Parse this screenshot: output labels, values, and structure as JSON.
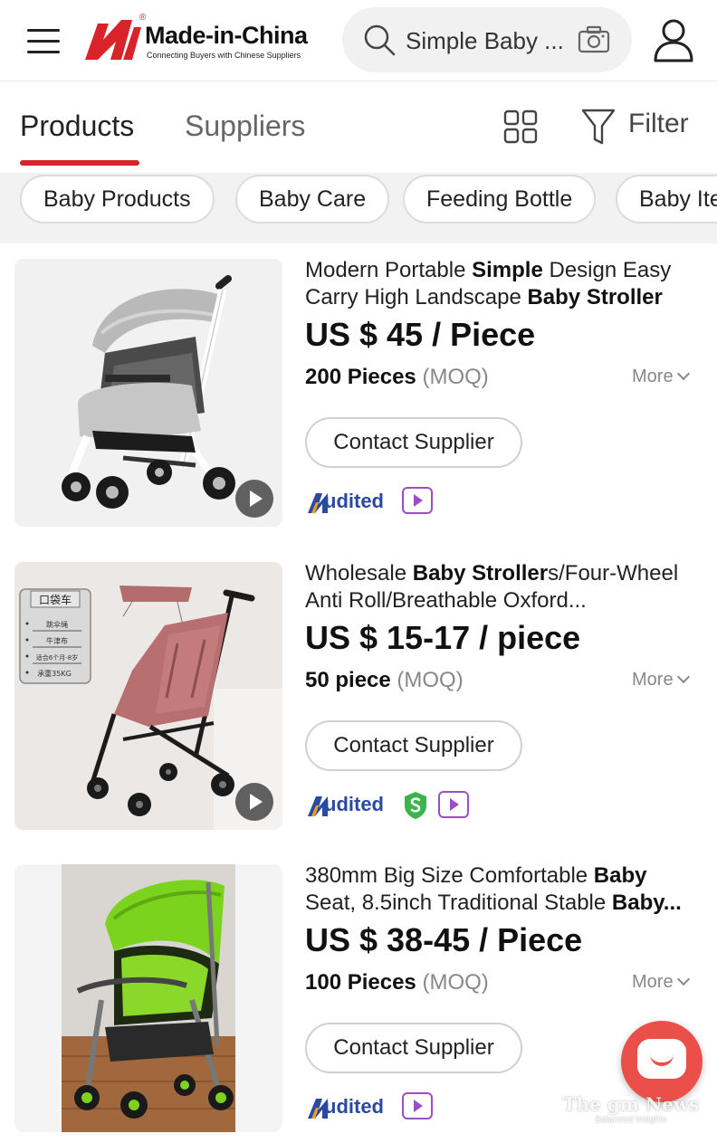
{
  "header": {
    "brand": "Made-in-China",
    "registered": "®",
    "tagline": "Connecting Buyers with Chinese Suppliers",
    "search_text": "Simple Baby ...",
    "accent_color": "#d8232a"
  },
  "tabs": {
    "products": "Products",
    "suppliers": "Suppliers",
    "active": "Products",
    "filter_label": "Filter"
  },
  "chips": [
    "Baby Products",
    "Baby Care",
    "Feeding Bottle",
    "Baby Ite"
  ],
  "products": [
    {
      "title_parts": [
        {
          "t": "Modern Portable ",
          "b": false
        },
        {
          "t": "Simple",
          "b": true
        },
        {
          "t": " Design Easy Carry High Landscape ",
          "b": false
        },
        {
          "t": "Baby Stroller",
          "b": true
        }
      ],
      "price": "US $ 45 / Piece",
      "moq_qty": "200 Pieces",
      "moq_label": "(MOQ)",
      "more": "More",
      "contact": "Contact Supplier",
      "audited": "Audited",
      "badges": [
        "video-icon"
      ],
      "has_video": true
    },
    {
      "title_parts": [
        {
          "t": "Wholesale ",
          "b": false
        },
        {
          "t": "Baby Stroller",
          "b": true
        },
        {
          "t": "s/Four-Wheel Anti Roll/Breathable Oxford...",
          "b": false
        }
      ],
      "price": "US $ 15-17 / piece",
      "moq_qty": "50 piece",
      "moq_label": "(MOQ)",
      "more": "More",
      "contact": "Contact Supplier",
      "audited": "Audited",
      "badges": [
        "shield-icon",
        "video-icon"
      ],
      "has_video": true,
      "image_label": {
        "heading": "口袋车",
        "lines": [
          "跳伞绳",
          "牛津布",
          "适合6个月-8岁",
          "承重35KG"
        ]
      }
    },
    {
      "title_parts": [
        {
          "t": "380mm Big Size Comfortable ",
          "b": false
        },
        {
          "t": "Baby",
          "b": true
        },
        {
          "t": " Seat, 8.5inch Traditional Stable ",
          "b": false
        },
        {
          "t": "Baby...",
          "b": true
        }
      ],
      "price": "US $ 38-45 / Piece",
      "moq_qty": "100 Pieces",
      "moq_label": "(MOQ)",
      "more": "More",
      "contact": "Contact Supplier",
      "audited": "Audited",
      "badges": [
        "video-icon"
      ],
      "has_video": false
    }
  ],
  "watermark": {
    "title": "The gm News",
    "subtitle": "Balanced Insights"
  }
}
